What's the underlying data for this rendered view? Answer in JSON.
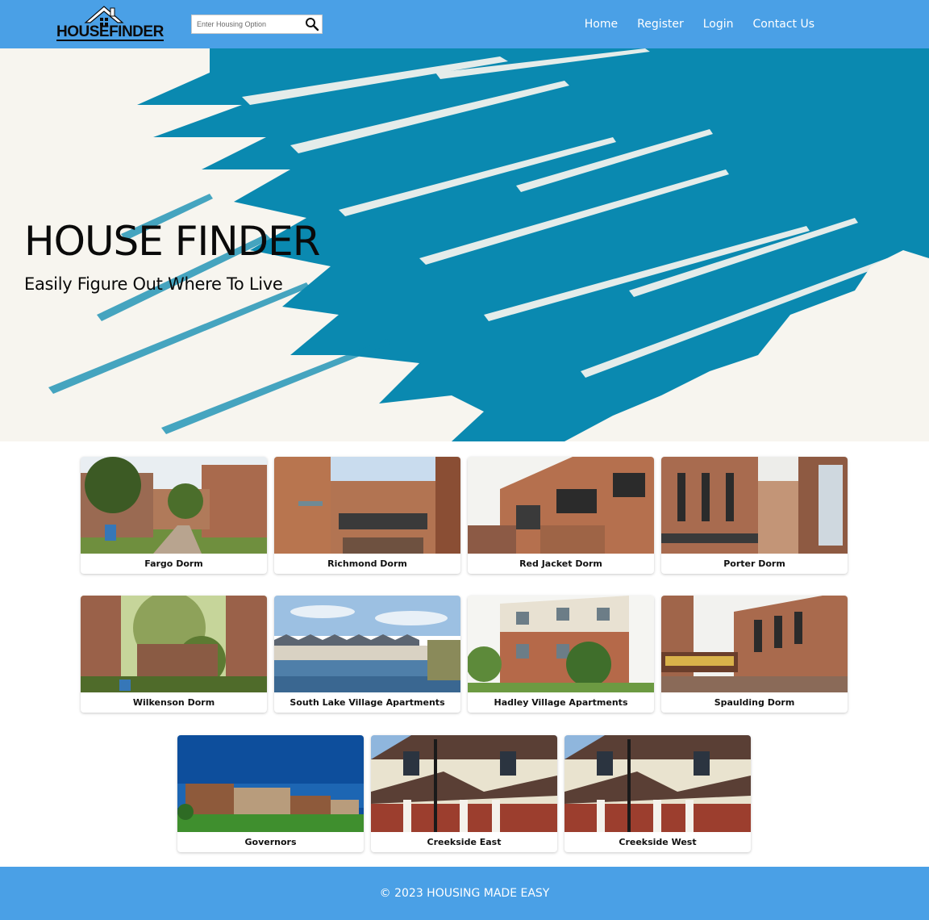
{
  "brand": {
    "logo_text": "HOUSEFINDER"
  },
  "search": {
    "placeholder": "Enter Housing Option",
    "value": ""
  },
  "nav": {
    "links": [
      {
        "label": "Home"
      },
      {
        "label": "Register"
      },
      {
        "label": "Login"
      },
      {
        "label": "Contact Us"
      }
    ]
  },
  "hero": {
    "title": "HOUSE FINDER",
    "subtitle": "Easily Figure Out Where To Live"
  },
  "listings": [
    {
      "label": "Fargo Dorm"
    },
    {
      "label": "Richmond Dorm"
    },
    {
      "label": "Red Jacket Dorm"
    },
    {
      "label": "Porter Dorm"
    },
    {
      "label": "Wilkenson Dorm"
    },
    {
      "label": "South Lake Village Apartments"
    },
    {
      "label": "Hadley Village Apartments"
    },
    {
      "label": "Spaulding Dorm"
    },
    {
      "label": "Governors"
    },
    {
      "label": "Creekside East"
    },
    {
      "label": "Creekside West"
    }
  ],
  "footer": {
    "text": "© 2023 HOUSING MADE EASY"
  },
  "colors": {
    "primary": "#4aa0e6",
    "hero_teal": "#0a89b0",
    "hero_white": "#f7f5ef",
    "brick": "#a96a4d"
  }
}
